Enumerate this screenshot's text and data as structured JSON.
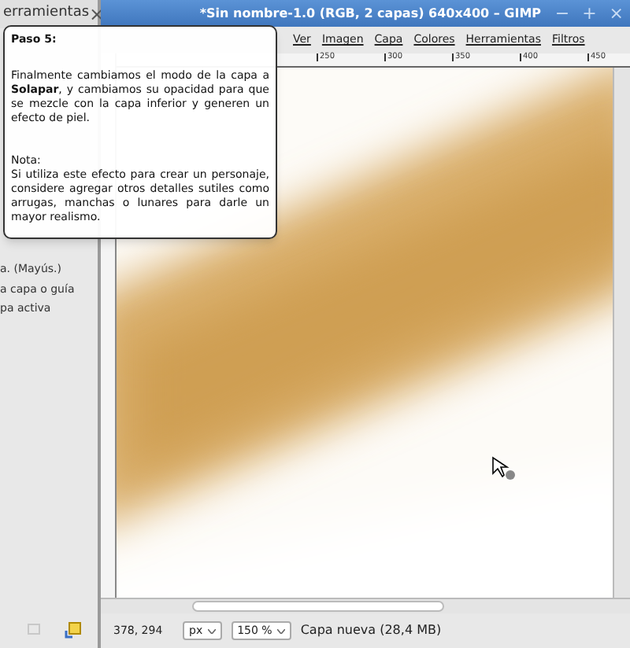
{
  "toolbox": {
    "title": "erramientas",
    "close": "×",
    "hints": [
      "a. (Mayús.)",
      "a capa o guía",
      "pa activa"
    ]
  },
  "window": {
    "title": "*Sin nombre-1.0 (RGB, 2 capas) 640x400 – GIMP",
    "controls": [
      "−",
      "+",
      "×"
    ]
  },
  "menu": [
    "Ver",
    "Imagen",
    "Capa",
    "Colores",
    "Herramientas",
    "Filtros"
  ],
  "ruler": [
    "250",
    "300",
    "350",
    "400",
    "450"
  ],
  "status_bar": {
    "pointer": "378, 294",
    "unit": "px",
    "zoom": "150 %",
    "layer": "Capa nueva (28,4 MB)"
  },
  "tooltip": {
    "heading": "Paso 5:",
    "body": "Finalmente cambiamos el modo de la capa a **Solapar**, y cambiamos su opacidad para que se mezcle con la capa inferior y generen un efecto de piel.",
    "note_heading": "Nota:",
    "note": "Si utiliza este efecto para crear un personaje, considere agregar otros detalles sutiles como arrugas, manchas o lunares para darle un mayor realismo."
  }
}
